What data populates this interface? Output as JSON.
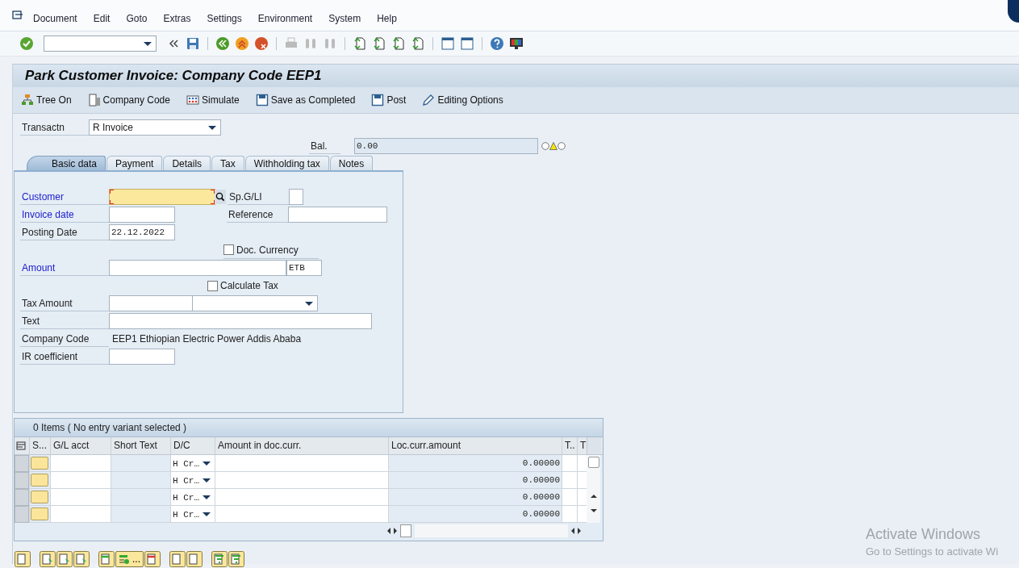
{
  "menu": [
    "Document",
    "Edit",
    "Goto",
    "Extras",
    "Settings",
    "Environment",
    "System",
    "Help"
  ],
  "title": "Park Customer Invoice: Company Code EEP1",
  "app_toolbar": [
    {
      "kind": "tree",
      "label": "Tree On"
    },
    {
      "kind": "company",
      "label": "Company Code"
    },
    {
      "kind": "simulate",
      "label": "Simulate"
    },
    {
      "kind": "save",
      "label": "Save as Completed"
    },
    {
      "kind": "save",
      "label": "Post"
    },
    {
      "kind": "pencil",
      "label": "Editing Options"
    }
  ],
  "transaction": {
    "label": "Transactn",
    "value": "R Invoice"
  },
  "balance": {
    "label": "Bal.",
    "value": "0.00",
    "warning": true
  },
  "tabs": [
    {
      "label": "Basic data",
      "selected": true
    },
    {
      "label": "Payment",
      "selected": false
    },
    {
      "label": "Details",
      "selected": false
    },
    {
      "label": "Tax",
      "selected": false
    },
    {
      "label": "Withholding tax",
      "selected": false
    },
    {
      "label": "Notes",
      "selected": false
    }
  ],
  "basic_data": {
    "customer": {
      "label": "Customer",
      "required": true
    },
    "sp_gl": {
      "label": "Sp.G/LI"
    },
    "invoice_date": {
      "label": "Invoice date",
      "required": true
    },
    "reference": {
      "label": "Reference"
    },
    "posting_date": {
      "label": "Posting Date",
      "value": "22.12.2022",
      "required": false
    },
    "doc_currency": {
      "label": "Doc. Currency",
      "checked": false
    },
    "amount": {
      "label": "Amount",
      "required": true,
      "currency": "ETB"
    },
    "calculate_tax": {
      "label": "Calculate Tax",
      "checked": false
    },
    "tax_amount": {
      "label": "Tax Amount"
    },
    "text": {
      "label": "Text"
    },
    "company_code": {
      "label": "Company Code",
      "value": "EEP1 Ethiopian Electric Power Addis Ababa"
    },
    "ir_coefficient": {
      "label": "IR coefficient"
    }
  },
  "items": {
    "title": "0 Items ( No entry variant selected )",
    "columns": [
      "S...",
      "G/L acct",
      "Short Text",
      "D/C",
      "Amount in doc.curr.",
      "Loc.curr.amount",
      "T..",
      "T"
    ],
    "rows": [
      {
        "dc": "H Cr…",
        "loc_amount": "0.00000"
      },
      {
        "dc": "H Cr…",
        "loc_amount": "0.00000"
      },
      {
        "dc": "H Cr…",
        "loc_amount": "0.00000"
      },
      {
        "dc": "H Cr…",
        "loc_amount": "0.00000"
      }
    ],
    "more_label": "..."
  },
  "os_watermark": {
    "title": "Activate Windows",
    "subtitle": "Go to Settings to activate Wi"
  }
}
